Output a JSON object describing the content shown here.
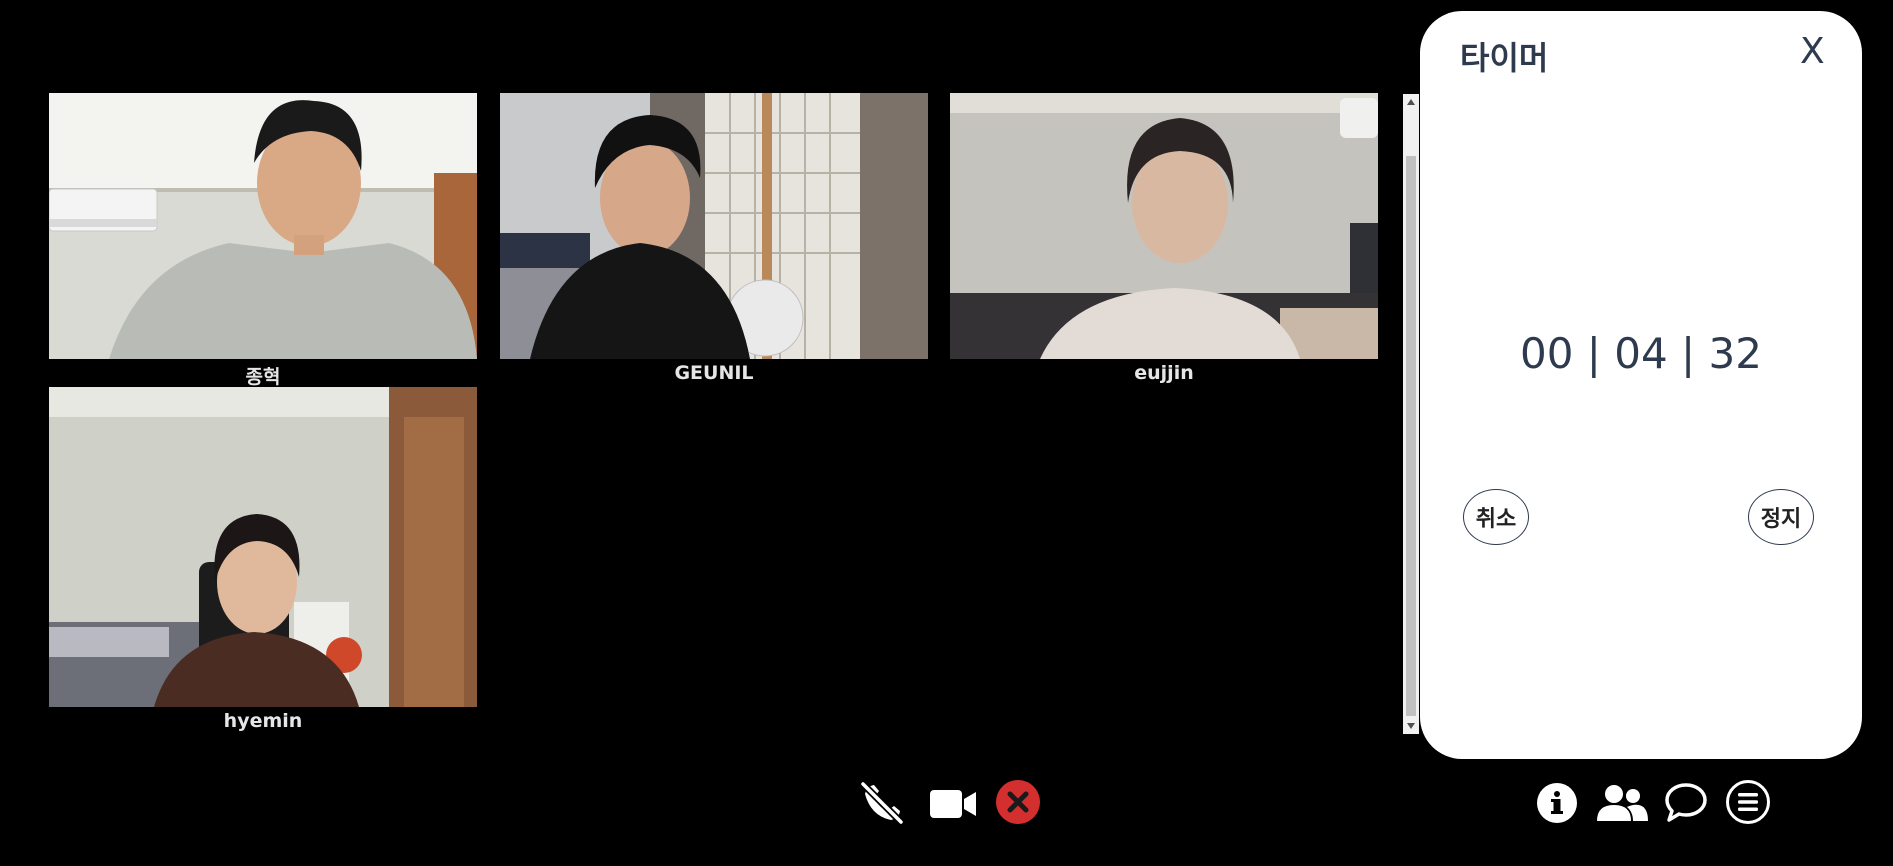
{
  "participants": [
    {
      "name": "종혁"
    },
    {
      "name": "GEUNIL"
    },
    {
      "name": "eujjin"
    },
    {
      "name": "hyemin"
    }
  ],
  "timer": {
    "title": "타이머",
    "close_label": "X",
    "display": "00 | 04 | 32",
    "cancel_label": "취소",
    "stop_label": "정지"
  },
  "controls": {
    "media": [
      "mic-muted-icon",
      "camera-icon",
      "leave-call-icon"
    ],
    "side": [
      "info-icon",
      "participants-icon",
      "chat-icon",
      "menu-icon"
    ]
  },
  "colors": {
    "background": "#000000",
    "panel": "#ffffff",
    "panel_text": "#2e3a4e",
    "leave_button": "#d32f2f"
  }
}
